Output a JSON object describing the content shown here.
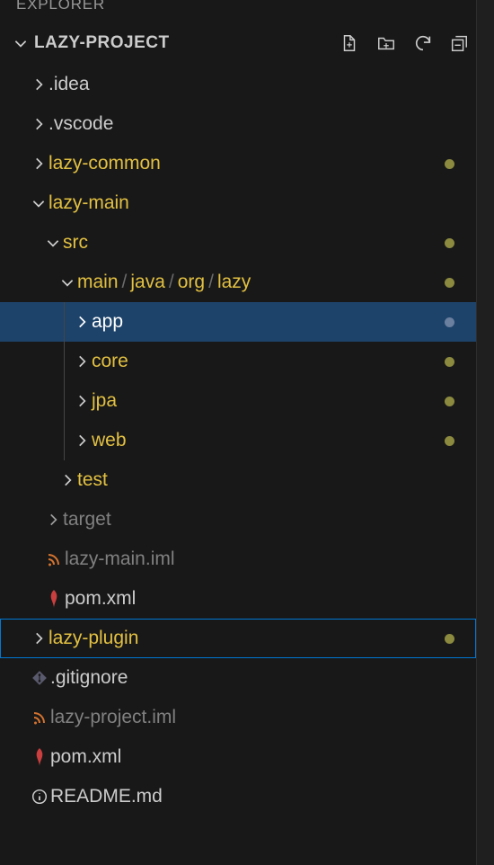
{
  "panel_title": "EXPLORER",
  "project_name": "LAZY-PROJECT",
  "tree": {
    "idea": ".idea",
    "vscode": ".vscode",
    "lazy_common": "lazy-common",
    "lazy_main": "lazy-main",
    "src": "src",
    "main_path_1": "main",
    "main_path_2": "java",
    "main_path_3": "org",
    "main_path_4": "lazy",
    "app": "app",
    "core": "core",
    "jpa": "jpa",
    "web": "web",
    "test": "test",
    "target": "target",
    "lazy_main_iml": "lazy-main.iml",
    "pom1": "pom.xml",
    "lazy_plugin": "lazy-plugin",
    "gitignore": ".gitignore",
    "lazy_project_iml": "lazy-project.iml",
    "pom2": "pom.xml",
    "readme": "README.md"
  }
}
